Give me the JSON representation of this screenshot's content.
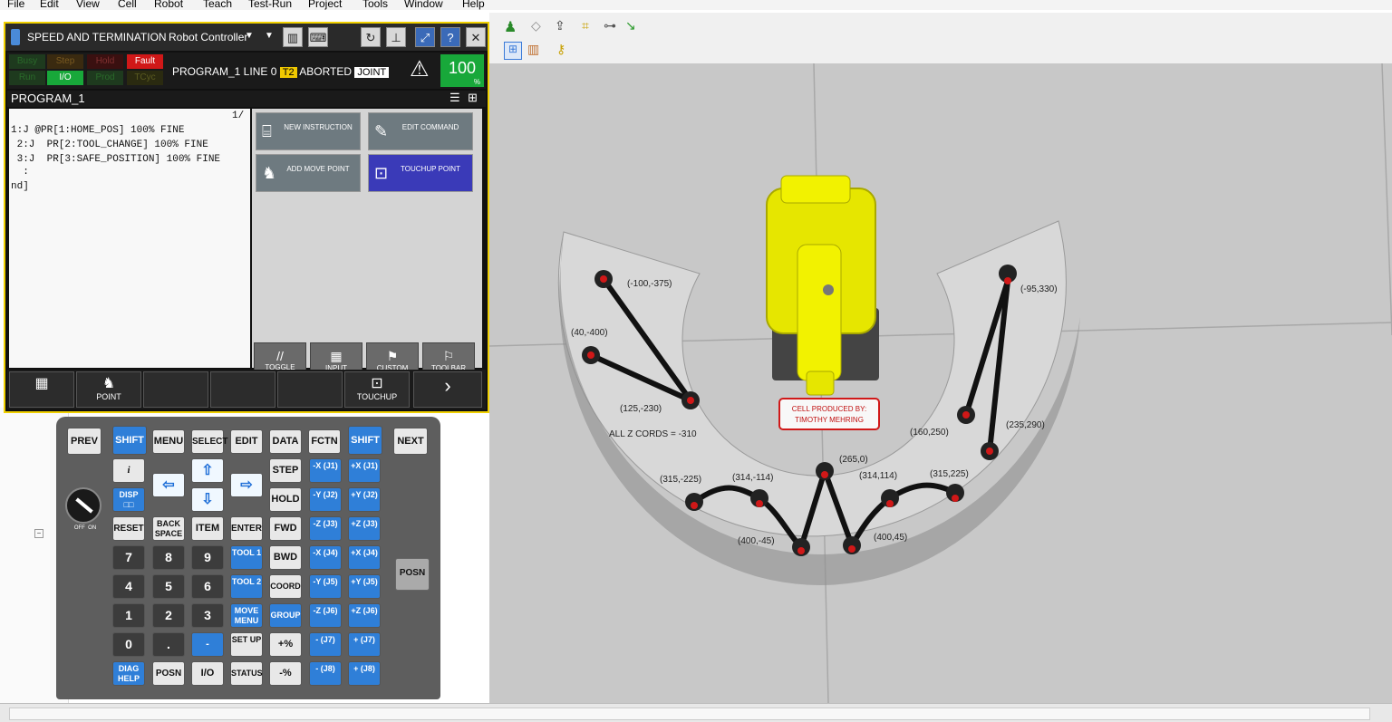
{
  "menubar": [
    "File",
    "Edit",
    "View",
    "Cell",
    "Robot",
    "Teach",
    "Test-Run",
    "Project",
    "Tools",
    "Window",
    "Help"
  ],
  "pendant": {
    "title": "SPEED AND TERMINATION",
    "controller": "Robot Controller",
    "leds_top": [
      "Busy",
      "Step",
      "Hold",
      "Fault"
    ],
    "leds_bottom": [
      "Run",
      "I/O",
      "Prod",
      "TCyc"
    ],
    "prog_status": "PROGRAM_1 LINE 0",
    "mode": "T2",
    "state": "ABORTED",
    "coord": "JOINT",
    "speed": "100",
    "speed_unit": "%",
    "program_name": "PROGRAM_1",
    "line_counter": "1/",
    "code_lines": [
      "1:J @PR[1:HOME_POS] 100% FINE",
      " 2:J  PR[2:TOOL_CHANGE] 100% FINE",
      " 3:J  PR[3:SAFE_POSITION] 100% FINE",
      "  :",
      "nd]"
    ],
    "commands": [
      {
        "label": "NEW INSTRUCTION"
      },
      {
        "label": "EDIT COMMAND"
      },
      {
        "label": "ADD MOVE POINT"
      },
      {
        "label": "TOUCHUP POINT"
      }
    ],
    "mini_buttons": [
      "TOGGLE",
      "INPUT",
      "CUSTOM",
      "TOOLBAR"
    ],
    "fkeys": [
      "",
      "POINT",
      "",
      "",
      "",
      "TOUCHUP",
      ""
    ]
  },
  "keypad": {
    "row1": [
      "PREV",
      "SHIFT",
      "MENU",
      "SELECT",
      "EDIT",
      "DATA",
      "FCTN",
      "SHIFT",
      "NEXT"
    ],
    "posn_side": "POSN",
    "knob_labels": "OFF  ON",
    "left_keys": [
      "i",
      "DISP",
      "RESET",
      "7",
      "4",
      "1",
      "0",
      "DIAG HELP"
    ],
    "col2": [
      "BACK SPACE",
      "8",
      "5",
      "2",
      ".",
      " POSN"
    ],
    "col3": [
      "ITEM",
      "9",
      "6",
      "3",
      "-",
      "I/O"
    ],
    "col4": [
      "ENTER",
      "TOOL 1",
      "TOOL 2",
      "MOVE MENU",
      "SET UP",
      "STATUS"
    ],
    "col5": [
      "STEP",
      "HOLD",
      "FWD",
      "BWD",
      "COORD",
      "GROUP",
      "+%",
      "-%"
    ],
    "jog_minus": [
      "-X (J1)",
      "-Y (J2)",
      "-Z (J3)",
      "-X (J4)",
      "-Y (J5)",
      "-Z (J6)",
      "- (J7)",
      "- (J8)"
    ],
    "jog_plus": [
      "+X (J1)",
      "+Y (J2)",
      "+Z (J3)",
      "+X (J4)",
      "+Y (J5)",
      "+Z (J6)",
      "+ (J7)",
      "+ (J8)"
    ]
  },
  "scene": {
    "points": [
      "(-100,-375)",
      "(40,-400)",
      "(125,-230)",
      "(-95,330)",
      "(160,250)",
      "(235,290)",
      "(315,-225)",
      "(314,-114)",
      "(265,0)",
      "(314,114)",
      "(315,225)",
      "(400,-45)",
      "(400,45)"
    ],
    "z_note": "ALL Z CORDS = -310",
    "sign": "CELL PRODUCED BY: TIMOTHY MEHRING"
  }
}
